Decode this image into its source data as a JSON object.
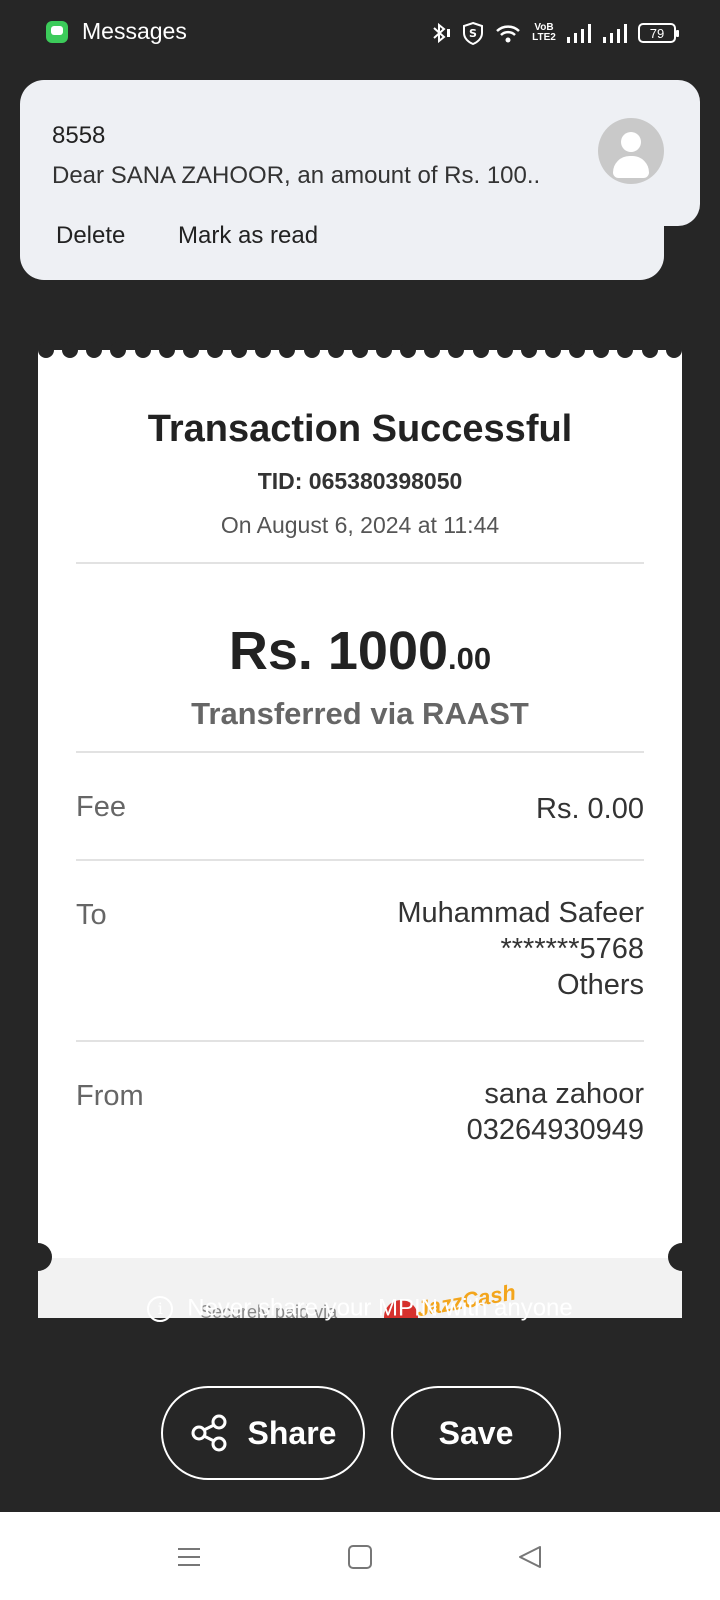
{
  "status_bar": {
    "app_name": "Messages",
    "volte_line1": "VoB",
    "volte_line2": "LTE2",
    "battery": "79"
  },
  "notification": {
    "sender": "8558",
    "body": "Dear SANA ZAHOOR, an amount of Rs. 100..",
    "actions": {
      "delete": "Delete",
      "mark_read": "Mark as read"
    }
  },
  "receipt": {
    "title": "Transaction Successful",
    "tid": "TID: 065380398050",
    "date": "On August 6, 2024 at 11:44",
    "amount_main": "Rs. 1000",
    "amount_decimal": ".00",
    "method": "Transferred via RAAST",
    "fee": {
      "label": "Fee",
      "value": "Rs. 0.00"
    },
    "to": {
      "label": "To",
      "name": "Muhammad Safeer",
      "account": "*******5768",
      "bank": "Others"
    },
    "from": {
      "label": "From",
      "name": "sana zahoor",
      "number": "03264930949"
    },
    "footer_text": "Securely paid via",
    "footer_logo_text": "JazzCash"
  },
  "warning": "Never share your MPIN with anyone",
  "buttons": {
    "share": "Share",
    "save": "Save"
  },
  "icons": {
    "app": "messages-icon",
    "info": "info-icon",
    "share": "share-icon",
    "nav_menu": "menu-icon",
    "nav_home": "home-square-icon",
    "nav_back": "back-triangle-icon"
  },
  "colors": {
    "background": "#262626",
    "receipt": "#ffffff",
    "notification": "#eef0f4",
    "app_icon": "#3ccb5a",
    "logo_red": "#d6312d",
    "logo_orange": "#f3a51c"
  }
}
